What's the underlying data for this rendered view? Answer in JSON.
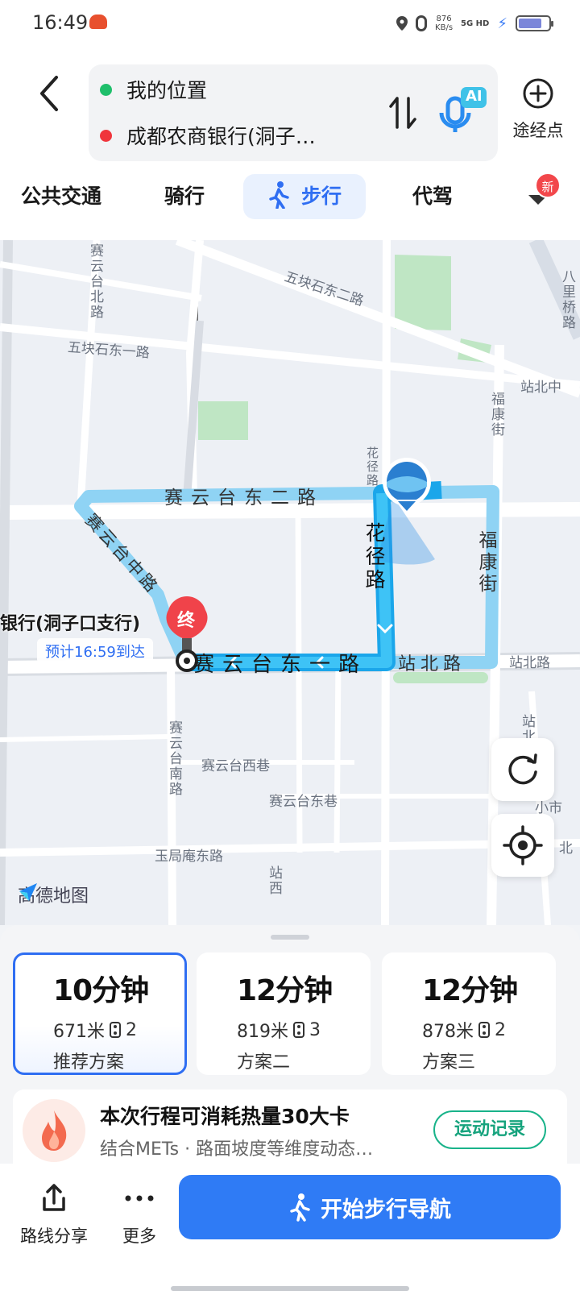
{
  "status": {
    "time": "16:49",
    "speed": "876",
    "speed_unit": "KB/s",
    "network": "5G HD"
  },
  "route": {
    "origin": "我的位置",
    "destination": "成都农商银行(洞子…",
    "waypoint_label": "途经点",
    "ai_badge": "AI"
  },
  "tabs": {
    "transit": "公共交通",
    "bike": "骑行",
    "walk": "步行",
    "drive": "代驾",
    "new_badge": "新"
  },
  "map": {
    "labels": {
      "wukuai_e2": "五块石东二路",
      "wukuai_e1": "五块石东一路",
      "saiyuntai_n": "赛云台北路",
      "zhanbeizhong": "站北中",
      "fukang_top": "福康街",
      "fukang_side": "福康街",
      "huajing_small": "花径路",
      "huajing_big": "花径路",
      "saiyun_e2": "赛云台东二路",
      "saiyun_zhong": "赛云台中路",
      "saiyun_e1": "赛云台东一路",
      "zhanbei_route": "站北路",
      "zhanbei_right": "站北路",
      "saiyun_s": "赛云台南路",
      "saiyun_w": "赛云台西巷",
      "saiyun_e": "赛云台东巷",
      "yujuan": "玉局庵东路",
      "zhan_bottom": "站西",
      "zhan_right": "站北",
      "xiaoshi": "小市",
      "bali": "八里桥路",
      "bei": "北"
    },
    "destination_label": "银行(洞子口支行)",
    "end_marker": "终",
    "eta": "预计16:59到达",
    "logo": "高德地图"
  },
  "plans": [
    {
      "time": "10分钟",
      "distance": "671米",
      "lights": "2",
      "tag": "推荐方案"
    },
    {
      "time": "12分钟",
      "distance": "819米",
      "lights": "3",
      "tag": "方案二"
    },
    {
      "time": "12分钟",
      "distance": "878米",
      "lights": "2",
      "tag": "方案三"
    }
  ],
  "calorie": {
    "title": "本次行程可消耗热量30大卡",
    "subtitle": "结合METs · 路面坡度等维度动态…",
    "button": "运动记录"
  },
  "actions": {
    "share": "路线分享",
    "more": "更多",
    "start": "开始步行导航"
  },
  "colors": {
    "accent": "#2f6ef2",
    "route": "#27b3ee",
    "green": "#1fbf6b",
    "red": "#f0353c",
    "sport": "#16a37d"
  }
}
